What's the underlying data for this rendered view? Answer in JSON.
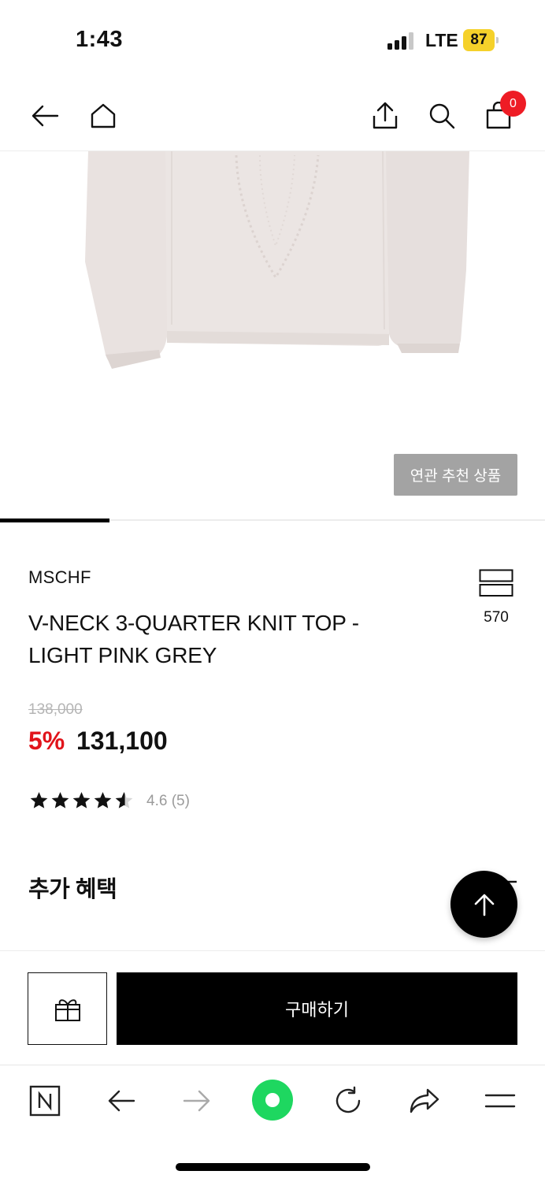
{
  "status_bar": {
    "time": "1:43",
    "network": "LTE",
    "battery": "87"
  },
  "top_nav": {
    "cart_count": "0"
  },
  "recommend_button": "연관 추천 상품",
  "product": {
    "brand": "MSCHF",
    "name": "V-NECK 3-QUARTER KNIT TOP - LIGHT PINK GREY",
    "likes": "570",
    "original_price": "138,000",
    "discount": "5%",
    "sale_price": "131,100",
    "rating_value": 4.6,
    "rating_text": "4.6 (5)"
  },
  "benefit_title": "추가 혜택",
  "buy_button": "구매하기",
  "colors": {
    "discount": "#e1141b",
    "badge": "#ee1c25",
    "battery": "#f5d12a",
    "browser_accent": "#1ed760",
    "sweater": "#e9e2e0"
  },
  "icons": [
    "back-icon",
    "home-icon",
    "share-icon",
    "search-icon",
    "cart-icon",
    "like-icon",
    "star-icon",
    "arrow-up-icon",
    "gift-icon",
    "naver-n-icon",
    "browser-back-icon",
    "browser-forward-icon",
    "green-dot-icon",
    "reload-icon",
    "forward-share-icon",
    "menu-icon"
  ]
}
